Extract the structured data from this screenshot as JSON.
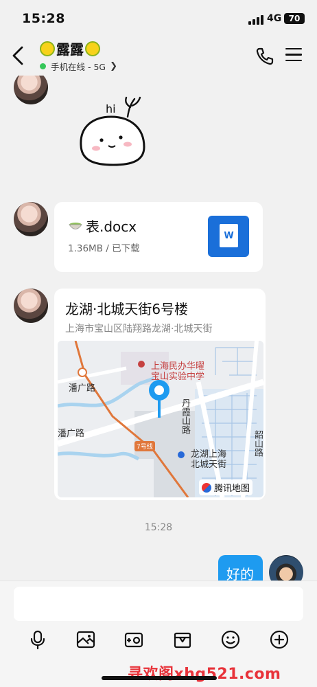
{
  "status_bar": {
    "time": "15:28",
    "network": "4G",
    "battery": "70"
  },
  "header": {
    "title": "露露",
    "status": "手机在线 - 5G",
    "left_emoji": "lemon",
    "right_emoji": "lemon"
  },
  "messages": [
    {
      "type": "sticker",
      "sender": "other",
      "sticker_text": "hi"
    },
    {
      "type": "file",
      "sender": "other",
      "file_name": "表.docx",
      "meta": "1.36MB / 已下载",
      "file_icon_text": "W"
    },
    {
      "type": "location",
      "sender": "other",
      "title": "龙湖·北城天街6号楼",
      "address": "上海市宝山区陆翔路龙湖·北城天街",
      "map": {
        "labels": {
          "school_line1": "上海民办华曜",
          "school_line2": "宝山实验中学",
          "road_pan": "潘广路",
          "road_pan_short": "潘广路",
          "road_danxia": "丹霞山路",
          "road_shaoshan": "韶山路",
          "mall_line1": "龙湖上海",
          "mall_line2": "北城天街",
          "metro_line": "7号线",
          "map_provider": "腾讯地图"
        }
      }
    },
    {
      "type": "timestamp",
      "text": "15:28"
    },
    {
      "type": "text",
      "sender": "me",
      "text": "好的"
    }
  ],
  "colors": {
    "accent": "#1e9bf0",
    "online": "#35c659",
    "file_icon": "#1a6fd9",
    "watermark": "#e8333a"
  },
  "toolbar": {
    "icons": [
      "microphone-icon",
      "image-icon",
      "video-icon",
      "gift-icon",
      "emoji-icon",
      "plus-icon"
    ]
  },
  "watermark": "寻欢阁xhg521.com"
}
